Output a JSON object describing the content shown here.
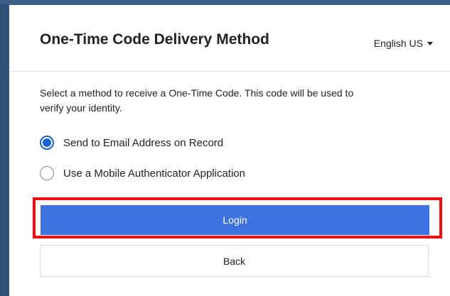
{
  "header": {
    "title": "One-Time Code Delivery Method",
    "language": "English US"
  },
  "main": {
    "description": "Select a method to receive a One-Time Code. This code will be used to verify your identity.",
    "options": [
      {
        "label": "Send to Email Address on Record",
        "selected": true
      },
      {
        "label": "Use a Mobile Authenticator Application",
        "selected": false
      }
    ],
    "login_label": "Login",
    "back_label": "Back"
  },
  "colors": {
    "primary": "#3d72df",
    "highlight": "#e81010",
    "background": "#3a5f86"
  }
}
